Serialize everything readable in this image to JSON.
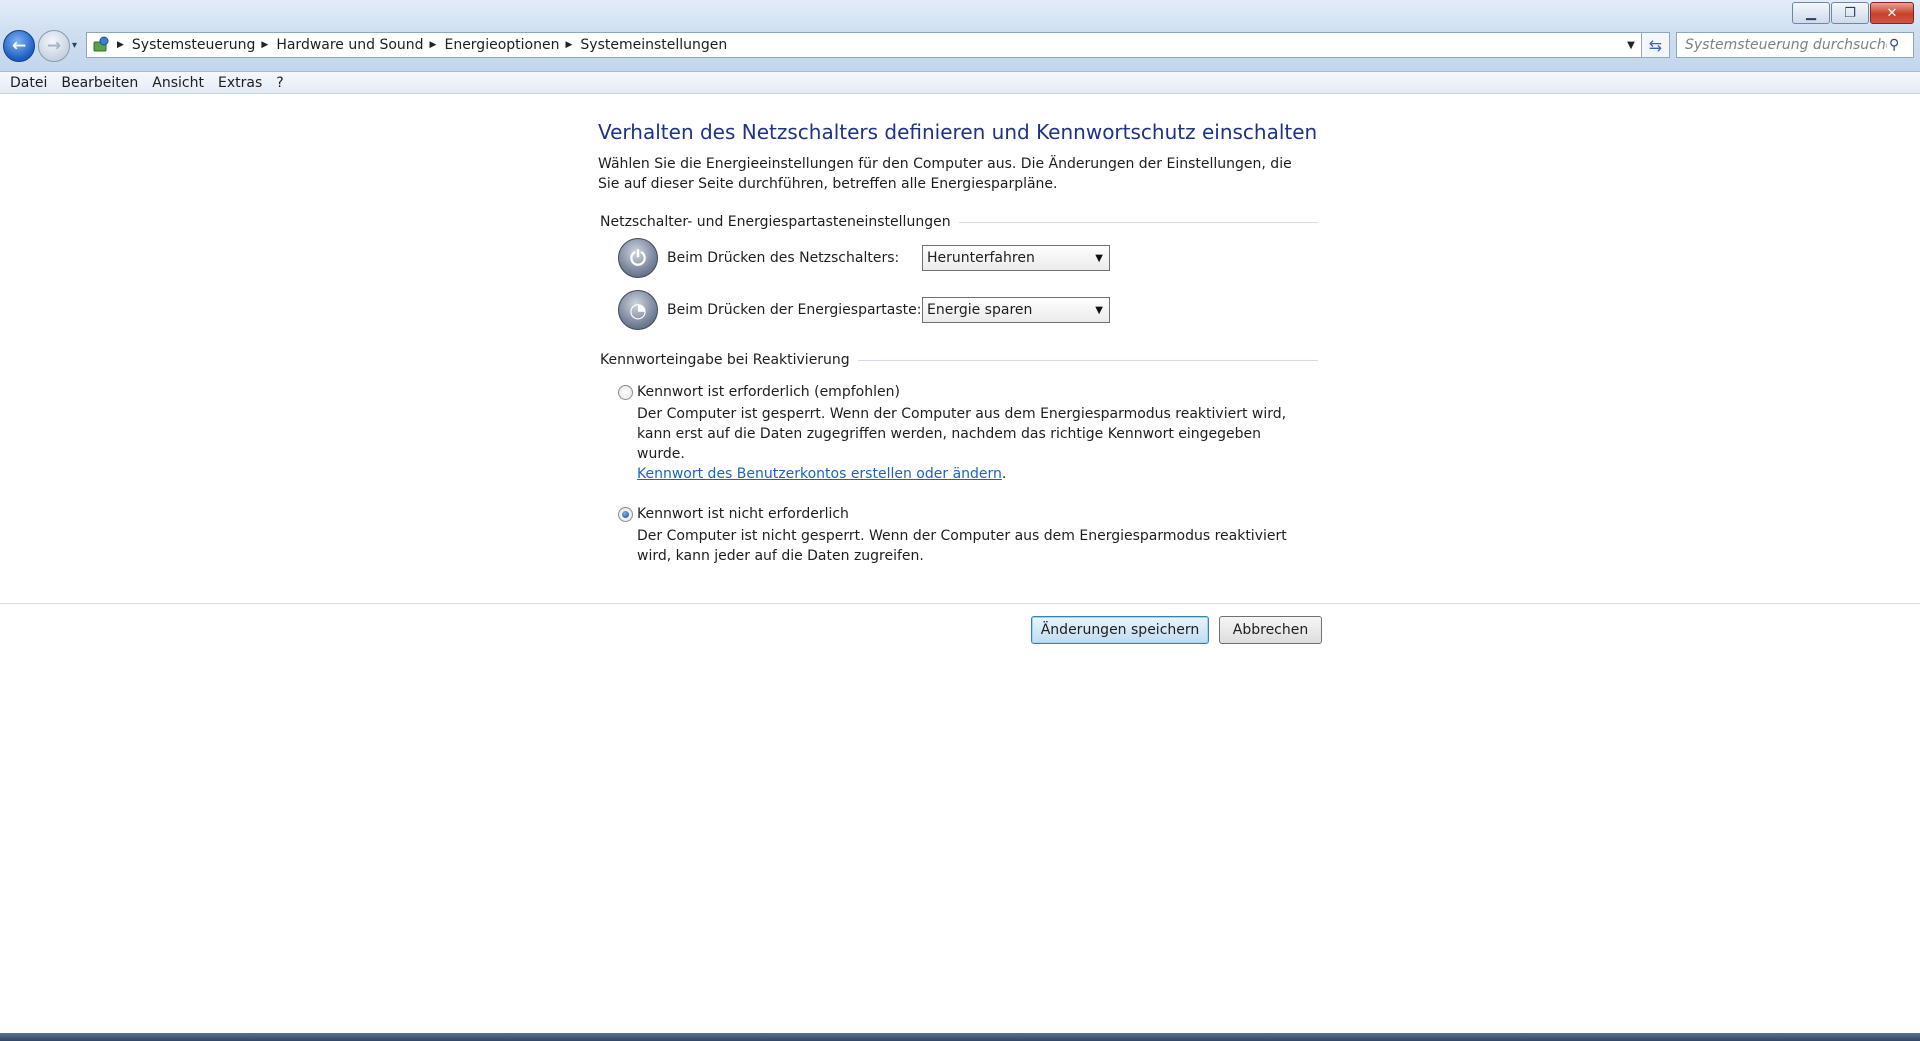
{
  "window": {
    "controls": {
      "minimize": "▁",
      "restore": "❐",
      "close": "✕"
    }
  },
  "nav": {
    "back_glyph": "←",
    "forward_glyph": "→",
    "recent_glyph": "▾"
  },
  "address_bar": {
    "icon": "control-panel-icon",
    "breadcrumbs": [
      "Systemsteuerung",
      "Hardware und Sound",
      "Energieoptionen",
      "Systemeinstellungen"
    ],
    "separator": "▶",
    "dropdown_glyph": "▼",
    "refresh_glyph": "⇆"
  },
  "search": {
    "placeholder": "Systemsteuerung durchsuchen",
    "icon_glyph": "⚲"
  },
  "menu": {
    "items": [
      "Datei",
      "Bearbeiten",
      "Ansicht",
      "Extras",
      "?"
    ]
  },
  "page": {
    "title": "Verhalten des Netzschalters definieren und Kennwortschutz einschalten",
    "description": "Wählen Sie die Energieeinstellungen für den Computer aus. Die Änderungen der Einstellungen, die Sie auf dieser Seite durchführen, betreffen alle Energiesparpläne."
  },
  "power_settings": {
    "group_title": "Netzschalter- und Energiespartasteneinstellungen",
    "rows": [
      {
        "icon": "power-button-icon",
        "icon_glyph": "⏻",
        "label": "Beim Drücken des Netzschalters:",
        "value": "Herunterfahren"
      },
      {
        "icon": "sleep-button-icon",
        "icon_glyph": "◔",
        "label": "Beim Drücken der Energiespartaste:",
        "value": "Energie sparen"
      }
    ]
  },
  "password_settings": {
    "group_title": "Kennworteingabe bei Reaktivierung",
    "options": [
      {
        "label": "Kennwort ist erforderlich (empfohlen)",
        "checked": false,
        "description": "Der Computer ist gesperrt. Wenn der Computer aus dem Energiesparmodus reaktiviert wird, kann erst auf die Daten zugegriffen werden, nachdem das richtige Kennwort eingegeben wurde.",
        "link": "Kennwort des Benutzerkontos erstellen oder ändern",
        "link_suffix": "."
      },
      {
        "label": "Kennwort ist nicht erforderlich",
        "checked": true,
        "description": "Der Computer ist nicht gesperrt. Wenn der Computer aus dem Energiesparmodus reaktiviert wird, kann jeder auf die Daten zugreifen."
      }
    ]
  },
  "buttons": {
    "save": "Änderungen speichern",
    "cancel": "Abbrechen"
  },
  "colors": {
    "title_blue": "#1e3287",
    "link_blue": "#1b62c7",
    "chrome_gradient_top": "#e3edf8",
    "chrome_gradient_bottom": "#c3d6ec"
  }
}
